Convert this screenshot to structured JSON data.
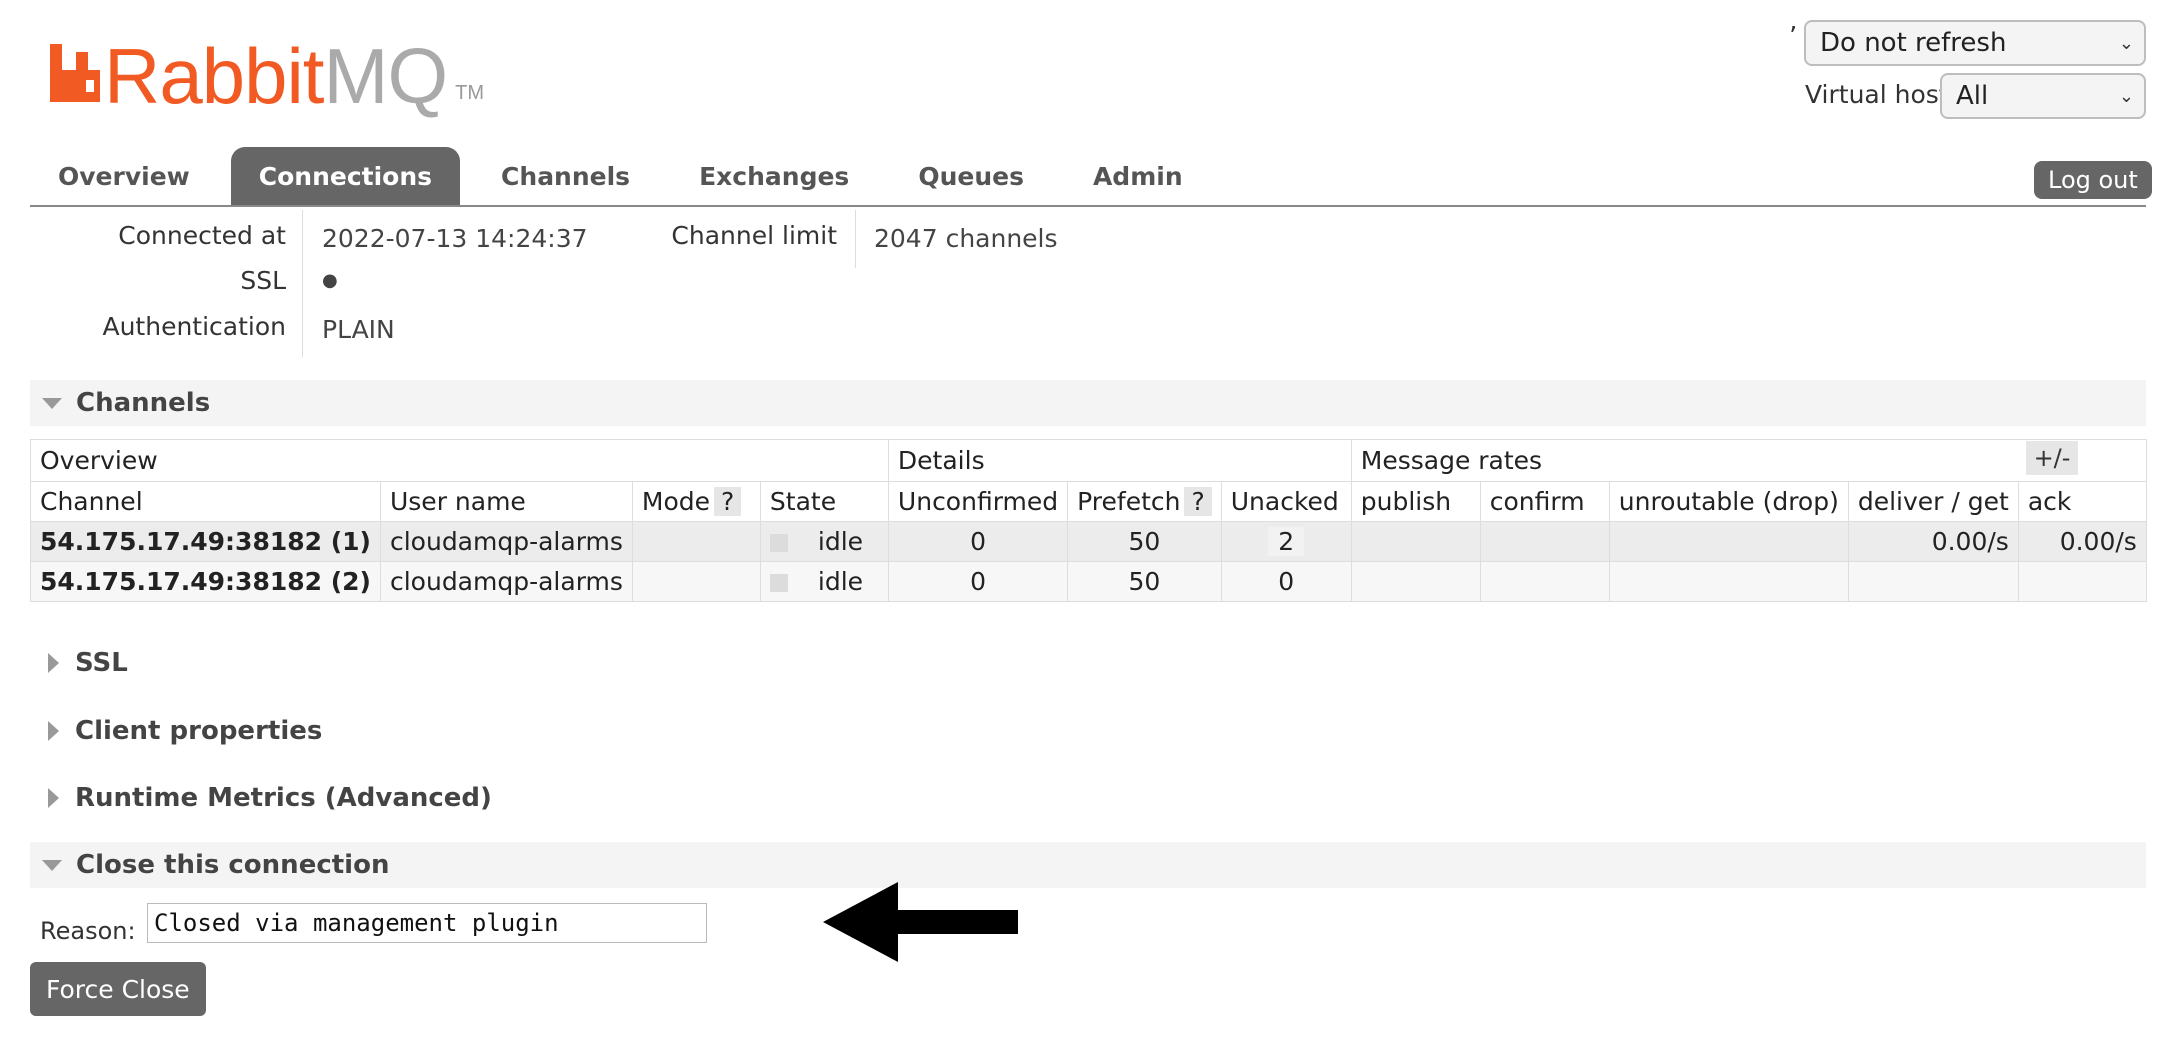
{
  "logo": {
    "brand_a": "Rabbit",
    "brand_b": "MQ",
    "tm": "TM",
    "color": "#f15a22"
  },
  "header": {
    "refresh_tick": "’",
    "refresh_value": "Do not refresh",
    "vhost_label": "Virtual host",
    "vhost_value": "All"
  },
  "tabs": [
    {
      "label": "Overview",
      "active": false
    },
    {
      "label": "Connections",
      "active": true
    },
    {
      "label": "Channels",
      "active": false
    },
    {
      "label": "Exchanges",
      "active": false
    },
    {
      "label": "Queues",
      "active": false
    },
    {
      "label": "Admin",
      "active": false
    }
  ],
  "logout_label": "Log out",
  "connection_info": {
    "connected_at_label": "Connected at",
    "connected_at_value": "2022-07-13 14:24:37",
    "ssl_label": "SSL",
    "ssl_value": "●",
    "auth_label": "Authentication",
    "auth_value": "PLAIN",
    "channel_limit_label": "Channel limit",
    "channel_limit_value": "2047 channels"
  },
  "sections": {
    "channels": "Channels",
    "ssl": "SSL",
    "client_properties": "Client properties",
    "runtime_metrics": "Runtime Metrics (Advanced)",
    "close_connection": "Close this connection"
  },
  "channels_table": {
    "groups": [
      "Overview",
      "Details",
      "Message rates"
    ],
    "plus_minus": "+/-",
    "help": "?",
    "columns": [
      "Channel",
      "User name",
      "Mode",
      "State",
      "Unconfirmed",
      "Prefetch",
      "Unacked",
      "publish",
      "confirm",
      "unroutable (drop)",
      "deliver / get",
      "ack"
    ],
    "rows": [
      {
        "channel": "54.175.17.49:38182 (1)",
        "user": "cloudamqp-alarms",
        "mode": "",
        "state": "idle",
        "unconfirmed": "0",
        "prefetch": "50",
        "unacked": "2",
        "publish": "",
        "confirm": "",
        "unroutable": "",
        "deliver_get": "0.00/s",
        "ack": "0.00/s"
      },
      {
        "channel": "54.175.17.49:38182 (2)",
        "user": "cloudamqp-alarms",
        "mode": "",
        "state": "idle",
        "unconfirmed": "0",
        "prefetch": "50",
        "unacked": "0",
        "publish": "",
        "confirm": "",
        "unroutable": "",
        "deliver_get": "",
        "ack": ""
      }
    ]
  },
  "close": {
    "reason_label": "Reason:",
    "reason_value": "Closed via management plugin",
    "force_close_label": "Force Close"
  }
}
